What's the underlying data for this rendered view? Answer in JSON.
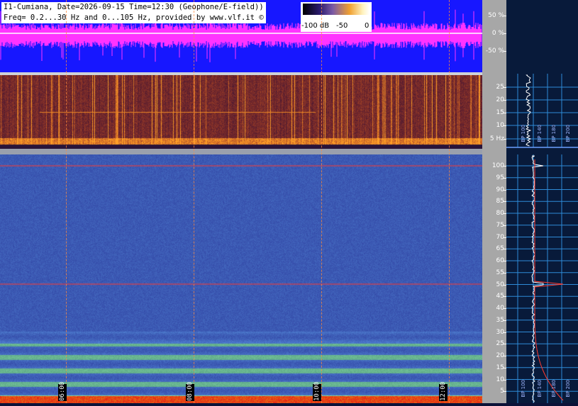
{
  "header": {
    "title_line1": "I1-Cumiana, Date=2026-09-15 Time=12:30 (Geophone/E-field))",
    "title_line2": "Freq= 0.2...30 Hz and 0...105 Hz, provided by www.vlf.it ©"
  },
  "legend": {
    "label_min": "-100 dB",
    "label_mid": "-50",
    "label_max": "0"
  },
  "wave_axis": {
    "ticks": [
      "50 %",
      "0 %",
      "-50 %"
    ]
  },
  "spec1_axis": {
    "ticks": [
      "25",
      "20",
      "15",
      "10",
      "5 Hz"
    ]
  },
  "spec2_axis": {
    "ticks": [
      "100",
      "95",
      "90",
      "85",
      "80",
      "75",
      "70",
      "65",
      "60",
      "55",
      "50",
      "45",
      "40",
      "35",
      "30",
      "25",
      "20",
      "15",
      "10",
      "5"
    ]
  },
  "time_labels": [
    "06:00",
    "08:00",
    "10:00",
    "12:00"
  ],
  "bp_labels_top": [
    "BP 100",
    "BP 140",
    "BP 180",
    "BP 200"
  ],
  "bp_labels_bottom": [
    "BP 100",
    "BP 140",
    "BP 180",
    "BP 200"
  ],
  "colors": {
    "wave_bg": "#1717ff",
    "wave_signal": "#ff33ff",
    "marker_line": "#ff3b30",
    "grid_blue": "#2e8bd8"
  }
}
